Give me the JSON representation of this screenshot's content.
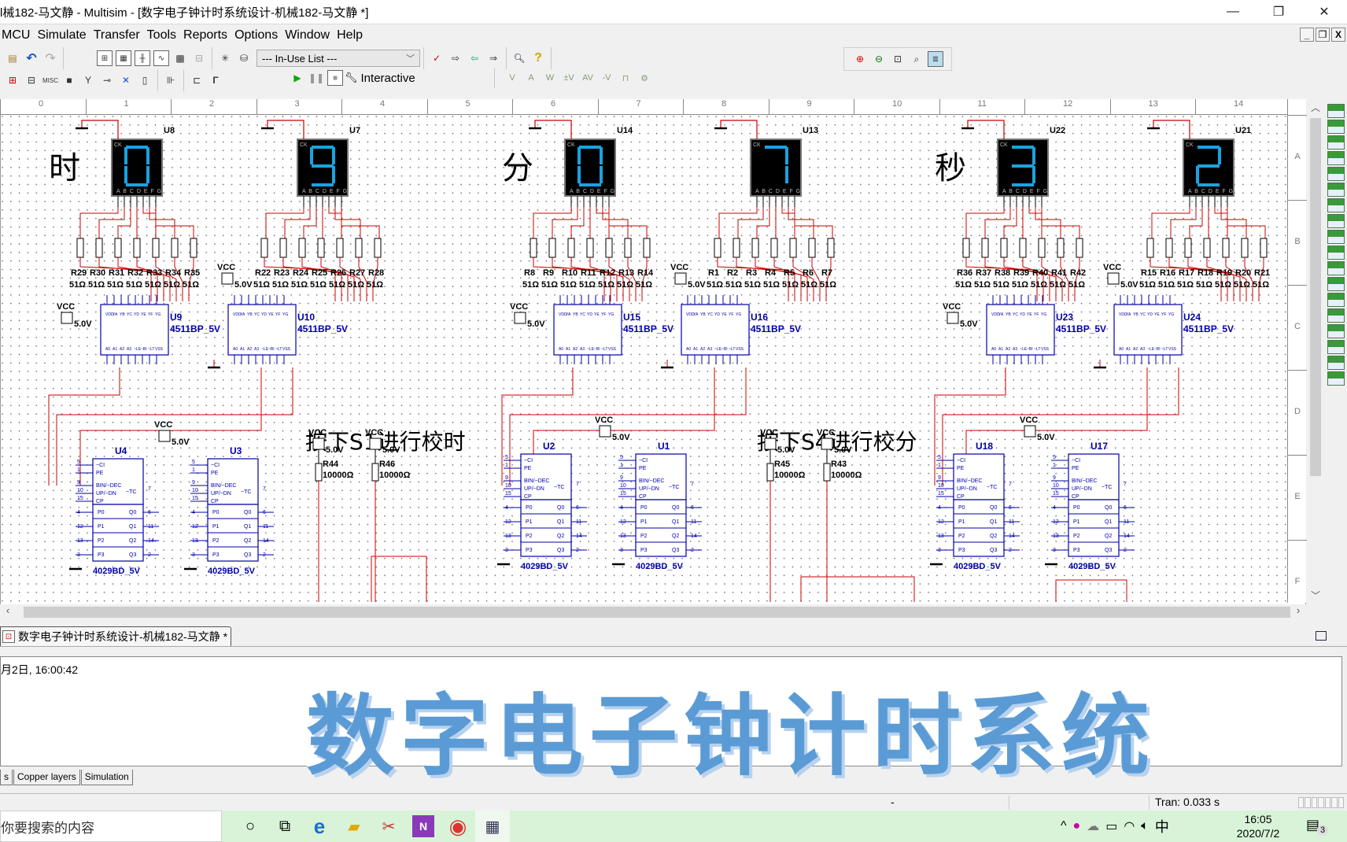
{
  "window": {
    "title": "l械182-马文静 - Multisim - [数字电子钟计时系统设计-机械182-马文静 *]",
    "minimize_glyph": "—",
    "restore_glyph": "❐",
    "close_glyph": "✕"
  },
  "menu": {
    "items": [
      {
        "label": "MCU",
        "accel": "M"
      },
      {
        "label": "Simulate",
        "accel": "S"
      },
      {
        "label": "Transfer",
        "accel": "n"
      },
      {
        "label": "Tools",
        "accel": "T"
      },
      {
        "label": "Reports",
        "accel": "R"
      },
      {
        "label": "Options",
        "accel": "O"
      },
      {
        "label": "Window",
        "accel": "W"
      },
      {
        "label": "Help",
        "accel": "H"
      }
    ],
    "mdi_controls": [
      "_",
      "❐",
      "X"
    ]
  },
  "toolbar": {
    "inuse_list": "--- In-Use List ---",
    "sim_mode": "Interactive",
    "icons_row1": [
      "paste-icon",
      "undo-icon",
      "redo-icon",
      "design-toolbox-icon",
      "spreadsheet-icon",
      "sim-toolbar-icon",
      "grapher-icon",
      "postprocessor-icon",
      "hierarchy-icon",
      "new-component-icon",
      "database-manager-icon",
      "erc-icon",
      "back-annotate-icon",
      "forward-annotate-icon",
      "transfer-icon",
      "find-icon",
      "help-icon"
    ],
    "icons_row2": [
      "source-icon",
      "basic-icon",
      "misc-icon",
      "indicator-icon",
      "rf-icon",
      "electromechanical-icon",
      "mcu-icon",
      "advanced-peripherals-icon",
      "hier-block-icon",
      "bus-icon",
      "place-text-icon"
    ],
    "instrument_probes": [
      "V",
      "A",
      "W",
      "±V",
      "AV",
      "-V",
      "⊓",
      "⚙"
    ],
    "zoom_icons": [
      "zoom-in-icon",
      "zoom-out-icon",
      "zoom-area-icon",
      "zoom-fit-icon",
      "full-screen-icon"
    ]
  },
  "ruler": {
    "columns": [
      "0",
      "1",
      "2",
      "3",
      "4",
      "5",
      "6",
      "7",
      "8",
      "9",
      "10",
      "11",
      "12",
      "13",
      "14"
    ],
    "rows": [
      "A",
      "B",
      "C",
      "D",
      "E",
      "F"
    ]
  },
  "schematic": {
    "sections": [
      {
        "label": "时",
        "displays": [
          {
            "ref": "U8",
            "digit": "0"
          },
          {
            "ref": "U7",
            "digit": "9"
          }
        ],
        "resistors_left": {
          "refs": [
            "R29",
            "R30",
            "R31",
            "R32",
            "R33",
            "R34",
            "R35"
          ],
          "value": "51Ω"
        },
        "resistors_right": {
          "refs": [
            "R22",
            "R23",
            "R24",
            "R25",
            "R26",
            "R27",
            "R28"
          ],
          "value": "51Ω"
        },
        "decoders": [
          {
            "ref": "U9",
            "part": "4511BP_5V"
          },
          {
            "ref": "U10",
            "part": "4511BP_5V"
          }
        ],
        "counters": [
          {
            "ref": "U4",
            "part": "4029BD_5V"
          },
          {
            "ref": "U3",
            "part": "4029BD_5V"
          }
        ]
      },
      {
        "label": "分",
        "displays": [
          {
            "ref": "U14",
            "digit": "0"
          },
          {
            "ref": "U13",
            "digit": "7"
          }
        ],
        "resistors_left": {
          "refs": [
            "R8",
            "R9",
            "R10",
            "R11",
            "R12",
            "R13",
            "R14"
          ],
          "value": "51Ω"
        },
        "resistors_right": {
          "refs": [
            "R1",
            "R2",
            "R3",
            "R4",
            "R5",
            "R6",
            "R7"
          ],
          "value": "51Ω"
        },
        "decoders": [
          {
            "ref": "U15",
            "part": "4511BP_5V"
          },
          {
            "ref": "U16",
            "part": "4511BP_5V"
          }
        ],
        "counters": [
          {
            "ref": "U2",
            "part": "4029BD_5V"
          },
          {
            "ref": "U1",
            "part": "4029BD_5V"
          }
        ]
      },
      {
        "label": "秒",
        "displays": [
          {
            "ref": "U22",
            "digit": "3"
          },
          {
            "ref": "U21",
            "digit": "2"
          }
        ],
        "resistors_left": {
          "refs": [
            "R36",
            "R37",
            "R38",
            "R39",
            "R40",
            "R41",
            "R42"
          ],
          "value": "51Ω"
        },
        "resistors_right": {
          "refs": [
            "R15",
            "R16",
            "R17",
            "R18",
            "R19",
            "R20",
            "R21"
          ],
          "value": "51Ω"
        },
        "decoders": [
          {
            "ref": "U23",
            "part": "4511BP_5V"
          },
          {
            "ref": "U24",
            "part": "4511BP_5V"
          }
        ],
        "counters": [
          {
            "ref": "U18",
            "part": "4029BD_5V"
          },
          {
            "ref": "U17",
            "part": "4029BD_5V"
          }
        ]
      }
    ],
    "notes": [
      {
        "text": "按下S1进行校时",
        "pullups": [
          {
            "ref": "R44",
            "value": "10000Ω"
          },
          {
            "ref": "R46",
            "value": "10000Ω"
          }
        ]
      },
      {
        "text": "按下S4进行校分",
        "pullups": [
          {
            "ref": "R45",
            "value": "10000Ω"
          },
          {
            "ref": "R43",
            "value": "10000Ω"
          }
        ]
      }
    ],
    "vcc_label": "VCC",
    "vcc_value": "5.0V",
    "display_pins": "A B C D E F G",
    "display_ck": "CK",
    "decoder_top_pins": [
      "VDD",
      "YA",
      "YB",
      "YC",
      "YD",
      "YE",
      "YF",
      "YG"
    ],
    "decoder_bottom_pins": [
      "A0",
      "A1",
      "A2",
      "A3",
      "~LE",
      "~BI",
      "~LT",
      "VSS"
    ],
    "counter_pins_left": [
      "~CI",
      "PE",
      "BIN/~DEC",
      "UP/~DN",
      "CP"
    ],
    "counter_pin_numbers": [
      "5",
      "1",
      "9",
      "10",
      "15"
    ],
    "counter_tc": "~TC",
    "counter_tc_pin": "7",
    "counter_p": [
      "P0",
      "P1",
      "P2",
      "P3"
    ],
    "counter_q": [
      "Q0",
      "Q1",
      "Q2",
      "Q3"
    ],
    "counter_p_nums": [
      "4",
      "12",
      "13",
      "3"
    ],
    "counter_q_nums": [
      "6",
      "11",
      "14",
      "2"
    ],
    "colors": {
      "wire": "#cc0000",
      "part": "#0000aa",
      "display_bg": "#000000",
      "segment": "#1aa3e0"
    }
  },
  "doc_tab": {
    "label": "数字电子钟计时系统设计-机械182-马文静 *"
  },
  "info_panel": {
    "timestamp": "月2日, 16:00:42",
    "banner": "数字电子钟计时系统"
  },
  "bottom_tabs": [
    "s",
    "Copper layers",
    "Simulation"
  ],
  "status": {
    "dash": "-",
    "tran": "Tran: 0.033 s"
  },
  "taskbar": {
    "search_placeholder": "你要搜索的内容",
    "apps": [
      {
        "name": "cortana",
        "glyph": "○"
      },
      {
        "name": "task-view",
        "glyph": "⧉"
      },
      {
        "name": "edge",
        "glyph": "e"
      },
      {
        "name": "file-explorer",
        "glyph": "▰"
      },
      {
        "name": "snip",
        "glyph": "✂"
      },
      {
        "name": "onenote",
        "glyph": "N"
      },
      {
        "name": "chrome",
        "glyph": "◉"
      },
      {
        "name": "multisim",
        "glyph": "▦"
      }
    ],
    "tray": {
      "chevron": "^",
      "ime": "中",
      "time": "16:05",
      "date": "2020/7/2",
      "notifications": "3"
    }
  }
}
